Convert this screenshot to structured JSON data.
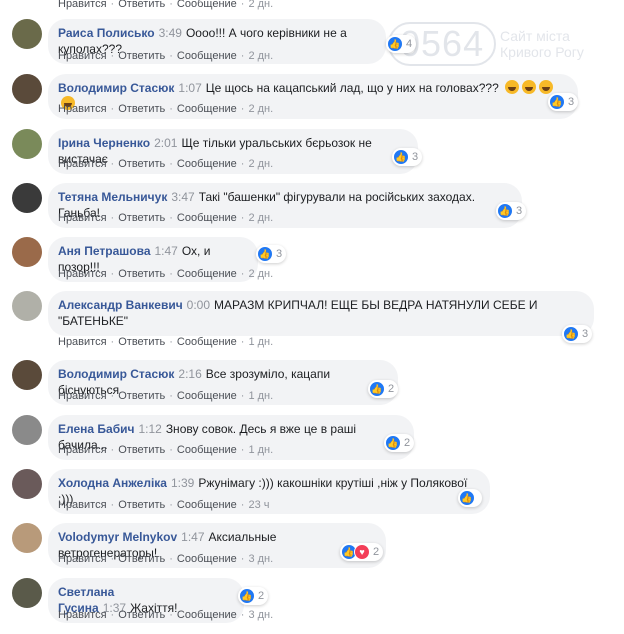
{
  "actions": {
    "like": "Нравится",
    "reply": "Ответить",
    "message": "Сообщение",
    "dot": "·"
  },
  "watermark": {
    "number": "0564",
    "line1": "Сайт міста",
    "line2": "Кривого Рогу"
  },
  "top_row": {
    "age": "2 дн."
  },
  "comments": [
    {
      "name": "Раиса Полисько",
      "time": "3:49",
      "text": "Оооо!!! А чого керівники не а куполах???",
      "age": "2 дн.",
      "reaction_count": "4",
      "reactions": [
        "like-icon"
      ]
    },
    {
      "name": "Володимир Стасюк",
      "time": "1:07",
      "text": "Це щось на кацапський лад, що у них на головах???",
      "emojis": 4,
      "age": "2 дн.",
      "reaction_count": "3",
      "reactions": [
        "like-icon"
      ]
    },
    {
      "name": "Ірина Черненко",
      "time": "2:01",
      "text": "Ще тільки уральських бєрьозок не вистачає",
      "age": "2 дн.",
      "reaction_count": "3",
      "reactions": [
        "like-icon"
      ]
    },
    {
      "name": "Тетяна Мельничук",
      "time": "3:47",
      "text": "Такі \"башенки\" фігурували на російських заходах. Ганьба!",
      "age": "2 дн.",
      "reaction_count": "3",
      "reactions": [
        "like-icon"
      ]
    },
    {
      "name": "Аня Петрашова",
      "time": "1:47",
      "text": "Ох, и позор!!!",
      "age": "2 дн.",
      "reaction_count": "3",
      "reactions": [
        "like-icon"
      ]
    },
    {
      "name": "Александр Ванкевич",
      "time": "0:00",
      "text": "МАРАЗМ КРИПЧАЛ! ЕЩЕ БЫ ВЕДРА НАТЯНУЛИ СЕБЕ И",
      "text2": "\"БАТЕНЬКЕ\"",
      "age": "1 дн.",
      "reaction_count": "3",
      "reactions": [
        "like-icon"
      ]
    },
    {
      "name": "Володимир Стасюк",
      "time": "2:16",
      "text": "Все зрозуміло, кацапи біснуються",
      "age": "1 дн.",
      "reaction_count": "2",
      "reactions": [
        "like-icon"
      ]
    },
    {
      "name": "Елена Бабич",
      "time": "1:12",
      "text": "Знову совок. Десь я вже це в раші бачила...",
      "age": "1 дн.",
      "reaction_count": "2",
      "reactions": [
        "like-icon"
      ]
    },
    {
      "name": "Холодна Анжеліка",
      "time": "1:39",
      "text": "Ржунімагу :))) какошніки крутіші ,ніж у Полякової :)))",
      "age": "23 ч",
      "reaction_count": "",
      "reactions": [
        "like-icon"
      ]
    },
    {
      "name": "Volodymyr Melnykov",
      "time": "1:47",
      "text": "Аксиальные ветрогенераторы!",
      "age": "3 дн.",
      "reaction_count": "2",
      "reactions": [
        "like-icon",
        "love-icon"
      ]
    },
    {
      "name": "Светлана Гусина",
      "time": "1:37",
      "text": "Жахіття!",
      "age": "3 дн.",
      "reaction_count": "2",
      "reactions": [
        "like-icon"
      ]
    }
  ],
  "colors": {
    "name": "#385898",
    "bubble": "#f2f3f5",
    "like": "#2078f4",
    "meta": "#90949c"
  }
}
